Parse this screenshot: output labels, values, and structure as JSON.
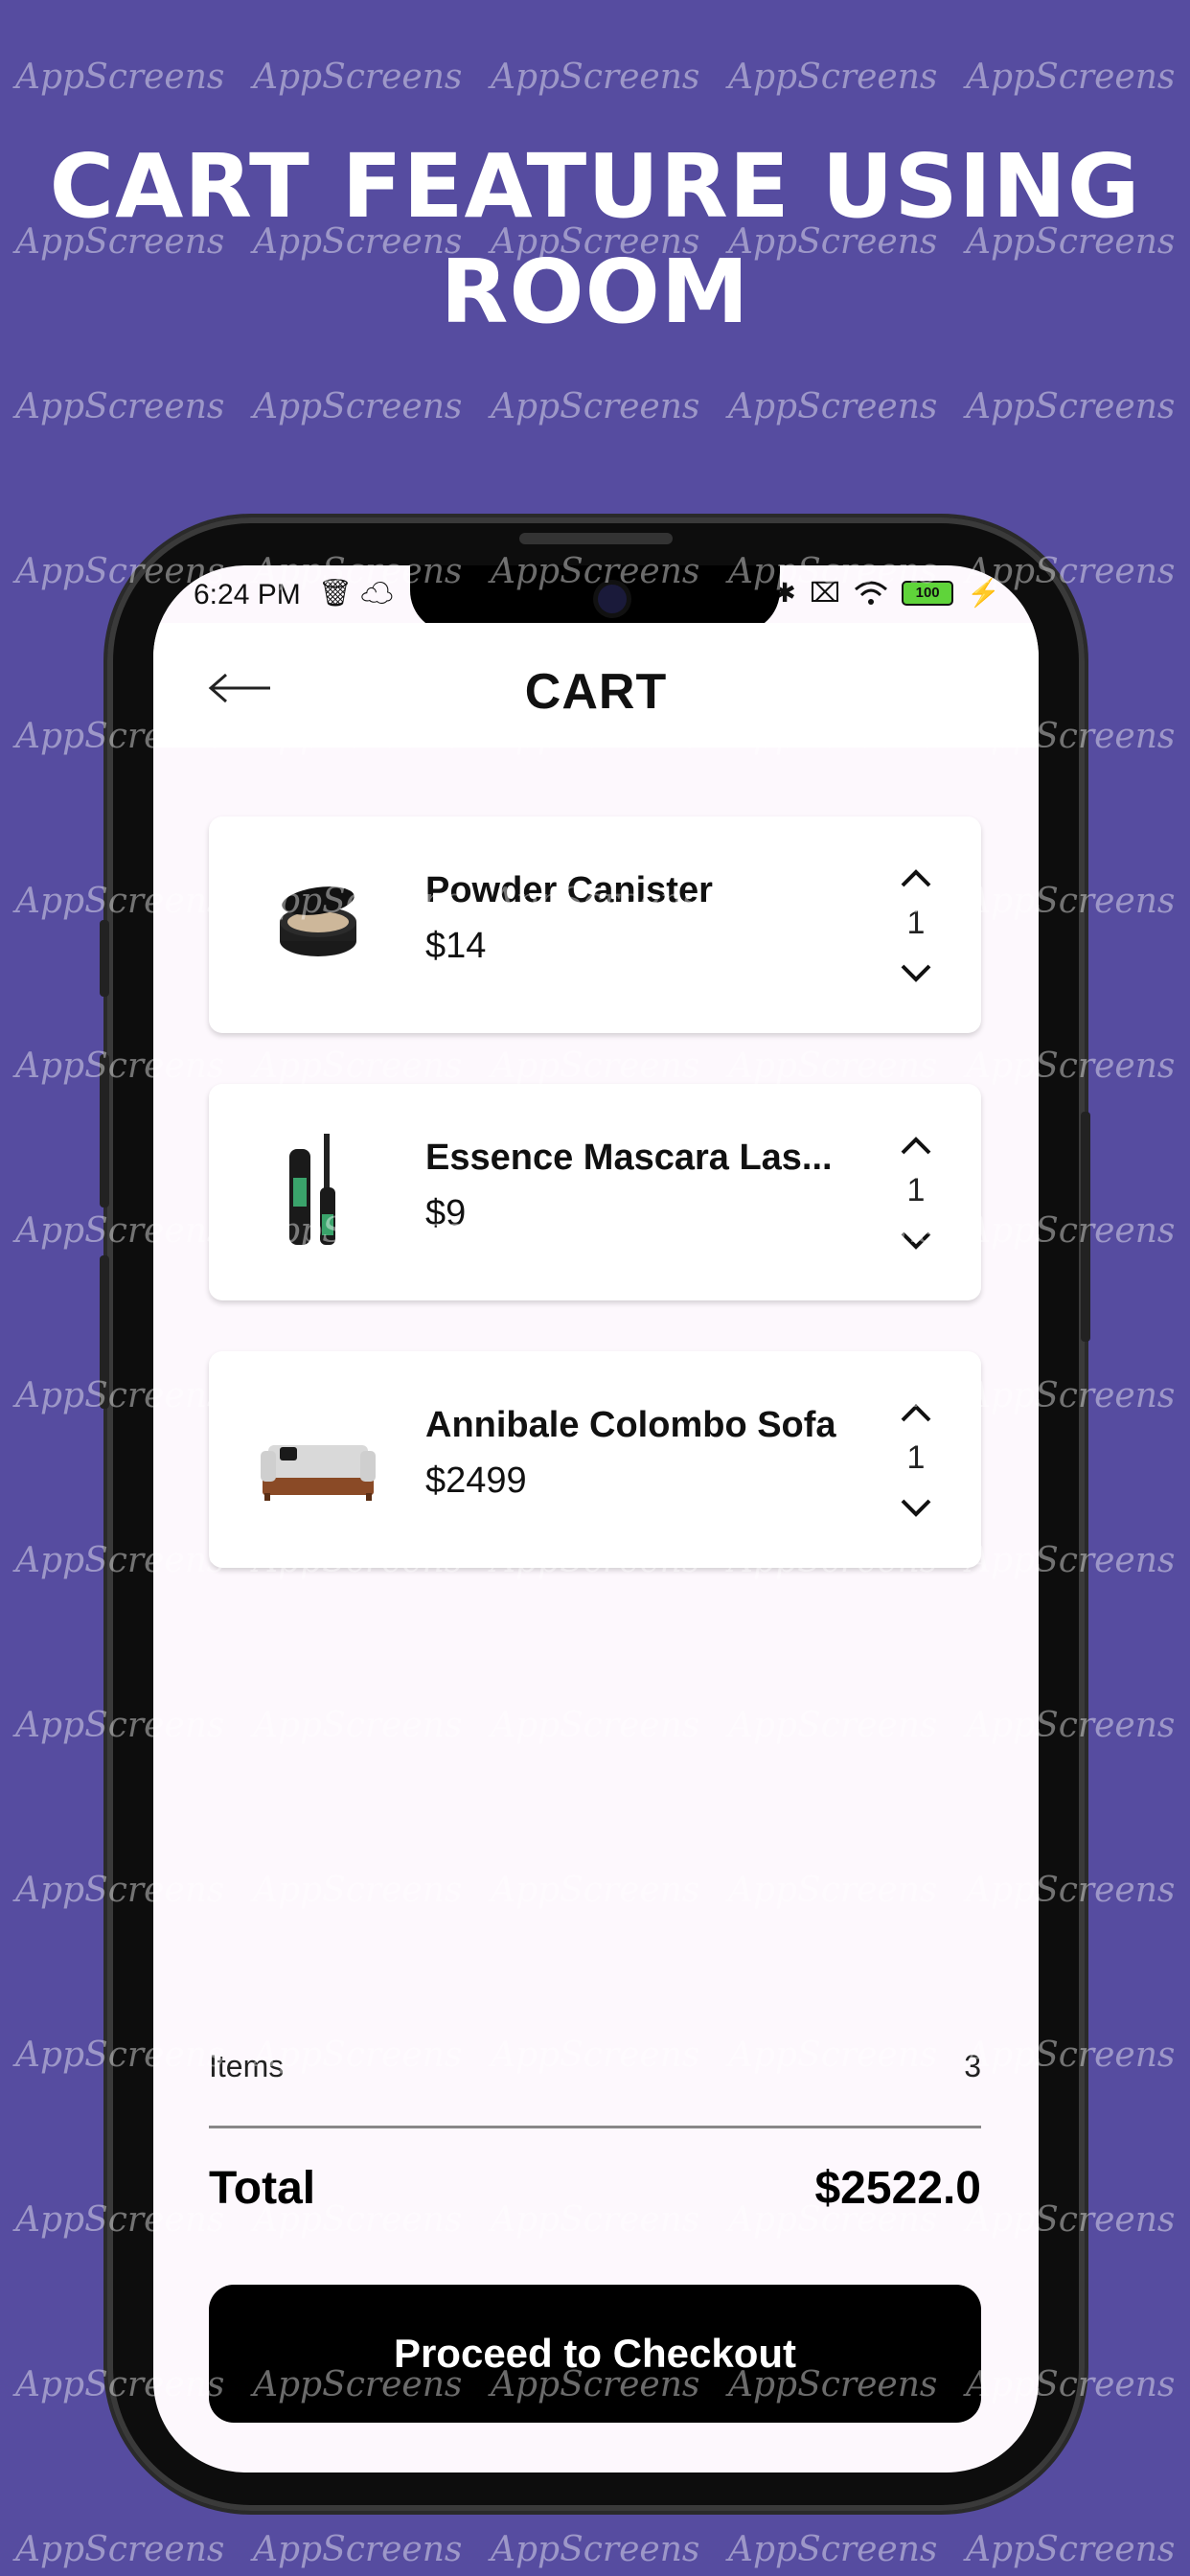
{
  "headline": {
    "line1": "CART FEATURE USING",
    "line2": "ROOM"
  },
  "watermark": "AppScreens",
  "status_bar": {
    "time": "6:24 PM",
    "battery": "100"
  },
  "header": {
    "title": "CART",
    "back_icon": "arrow-left-icon"
  },
  "cart": {
    "items": [
      {
        "name": "Powder Canister",
        "price": "$14",
        "quantity": "1",
        "image": "powder-compact-image"
      },
      {
        "name": "Essence Mascara Las...",
        "price": "$9",
        "quantity": "1",
        "image": "mascara-image"
      },
      {
        "name": "Annibale Colombo Sofa",
        "price": "$2499",
        "quantity": "1",
        "image": "sofa-image"
      }
    ]
  },
  "summary": {
    "items_label": "Items",
    "items_count": "3",
    "total_label": "Total",
    "total_value": "$2522.0"
  },
  "checkout": {
    "label": "Proceed to Checkout"
  },
  "colors": {
    "background": "#564ca0",
    "screen_background": "#fdf8fd",
    "button": "#000000",
    "text": "#111111"
  }
}
